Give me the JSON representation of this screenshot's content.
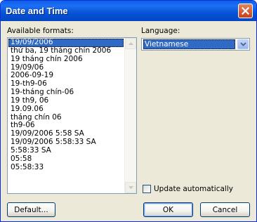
{
  "window": {
    "title": "Date and Time"
  },
  "formats": {
    "label": "Available formats:",
    "items": [
      "19/09/2006",
      "thứ ba, 19 tháng chín 2006",
      "19 tháng chín 2006",
      "19/09/06",
      "2006-09-19",
      "19-th9-06",
      "19-tháng chín-06",
      "19 th9, 06",
      "19.09.06",
      "tháng chín 06",
      "th9-06",
      "19/09/2006 5:58 SA",
      "19/09/2006 5:58:33 SA",
      "5:58:33 SA",
      "05:58",
      "05:58:33"
    ]
  },
  "language": {
    "label": "Language:",
    "value": "Vietnamese"
  },
  "update": {
    "label": "Update automatically",
    "checked": false
  },
  "buttons": {
    "default": "Default...",
    "ok": "OK",
    "cancel": "Cancel"
  }
}
